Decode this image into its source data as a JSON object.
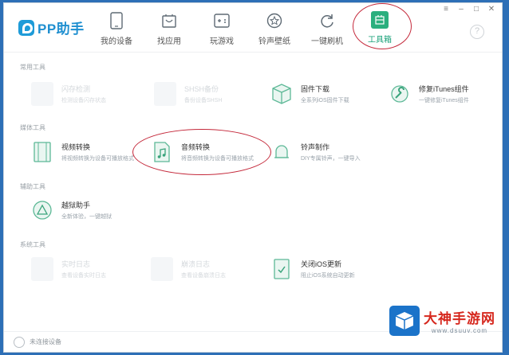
{
  "app": {
    "title": "PP助手"
  },
  "window_controls": {
    "menu": "≡",
    "minimize": "–",
    "maximize": "□",
    "close": "✕"
  },
  "help": "?",
  "nav": [
    {
      "label": "我的设备",
      "icon": "phone-icon"
    },
    {
      "label": "找应用",
      "icon": "bag-icon"
    },
    {
      "label": "玩游戏",
      "icon": "gamepad-icon"
    },
    {
      "label": "铃声壁纸",
      "icon": "star-icon"
    },
    {
      "label": "一键刷机",
      "icon": "refresh-icon"
    },
    {
      "label": "工具箱",
      "icon": "toolbox-icon"
    }
  ],
  "sections": {
    "s1": "常用工具",
    "s2": "媒体工具",
    "s3": "辅助工具",
    "s4": "系统工具"
  },
  "tools": {
    "t1": {
      "name": "闪存检测",
      "desc": "检测设备闪存状态"
    },
    "t2": {
      "name": "SHSH备份",
      "desc": "备份设备SHSH"
    },
    "firmware": {
      "name": "固件下载",
      "desc": "全系列iOS固件下载"
    },
    "itunes": {
      "name": "修复iTunes组件",
      "desc": "一键修复iTunes组件"
    },
    "video": {
      "name": "视频转换",
      "desc": "将视频转换为设备可播放格式"
    },
    "audio": {
      "name": "音频转换",
      "desc": "将音频转换为设备可播放格式"
    },
    "ringtone": {
      "name": "铃声制作",
      "desc": "DIY专属铃声，一键导入"
    },
    "assistant": {
      "name": "越狱助手",
      "desc": "全新体验，一键越狱"
    },
    "t9": {
      "name": "实时日志",
      "desc": "查看设备实时日志"
    },
    "t10": {
      "name": "崩溃日志",
      "desc": "查看设备崩溃日志"
    },
    "ios_update": {
      "name": "关闭iOS更新",
      "desc": "阻止iOS系统自动更新"
    }
  },
  "status": {
    "text": "未连接设备"
  },
  "watermark": {
    "title": "大神手游网",
    "url": "www.dsuuv.com"
  },
  "colors": {
    "accent": "#2aaf7e",
    "brand": "#1f8fd0",
    "annotation": "#c4283a"
  }
}
